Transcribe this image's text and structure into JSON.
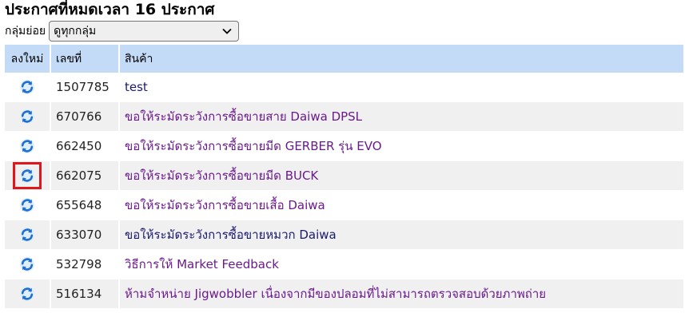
{
  "header": {
    "title": "ประกาศที่หมดเวลา 16 ประกาศ"
  },
  "filter": {
    "label": "กลุ่มย่อย",
    "selected": "ดูทุกกลุ่ม"
  },
  "table": {
    "columns": [
      "ลงใหม่",
      "เลขที่",
      "สินค้า"
    ],
    "rows": [
      {
        "id": "1507785",
        "product": "test"
      },
      {
        "id": "670766",
        "product": "ขอให้ระมัดระวังการซื้อขายสาย Daiwa DPSL"
      },
      {
        "id": "662450",
        "product": "ขอให้ระมัดระวังการซื้อขายมีด GERBER รุ่น EVO"
      },
      {
        "id": "662075",
        "product": "ขอให้ระมัดระวังการซื้อขายมีด BUCK"
      },
      {
        "id": "655648",
        "product": "ขอให้ระมัดระวังการซื้อขายเสื้อ Daiwa"
      },
      {
        "id": "633070",
        "product": "ขอให้ระมัดระวังการซื้อขายหมวก Daiwa"
      },
      {
        "id": "532798",
        "product": "วิธีการให้ Market Feedback"
      },
      {
        "id": "516134",
        "product": "ห้ามจำหน่าย Jigwobbler เนื่องจากมีของปลอมที่ไม่สามารถตรวจสอบด้วยภาพถ่าย"
      }
    ]
  },
  "colors": {
    "header_bg": "#c4dbf7",
    "stripe_bg": "#f0f0f0",
    "link_visited": "#6a1a8c",
    "selection_border": "#e0161a",
    "icon_blue": "#1f6fd0"
  },
  "icons": {
    "repost": "refresh-icon"
  }
}
